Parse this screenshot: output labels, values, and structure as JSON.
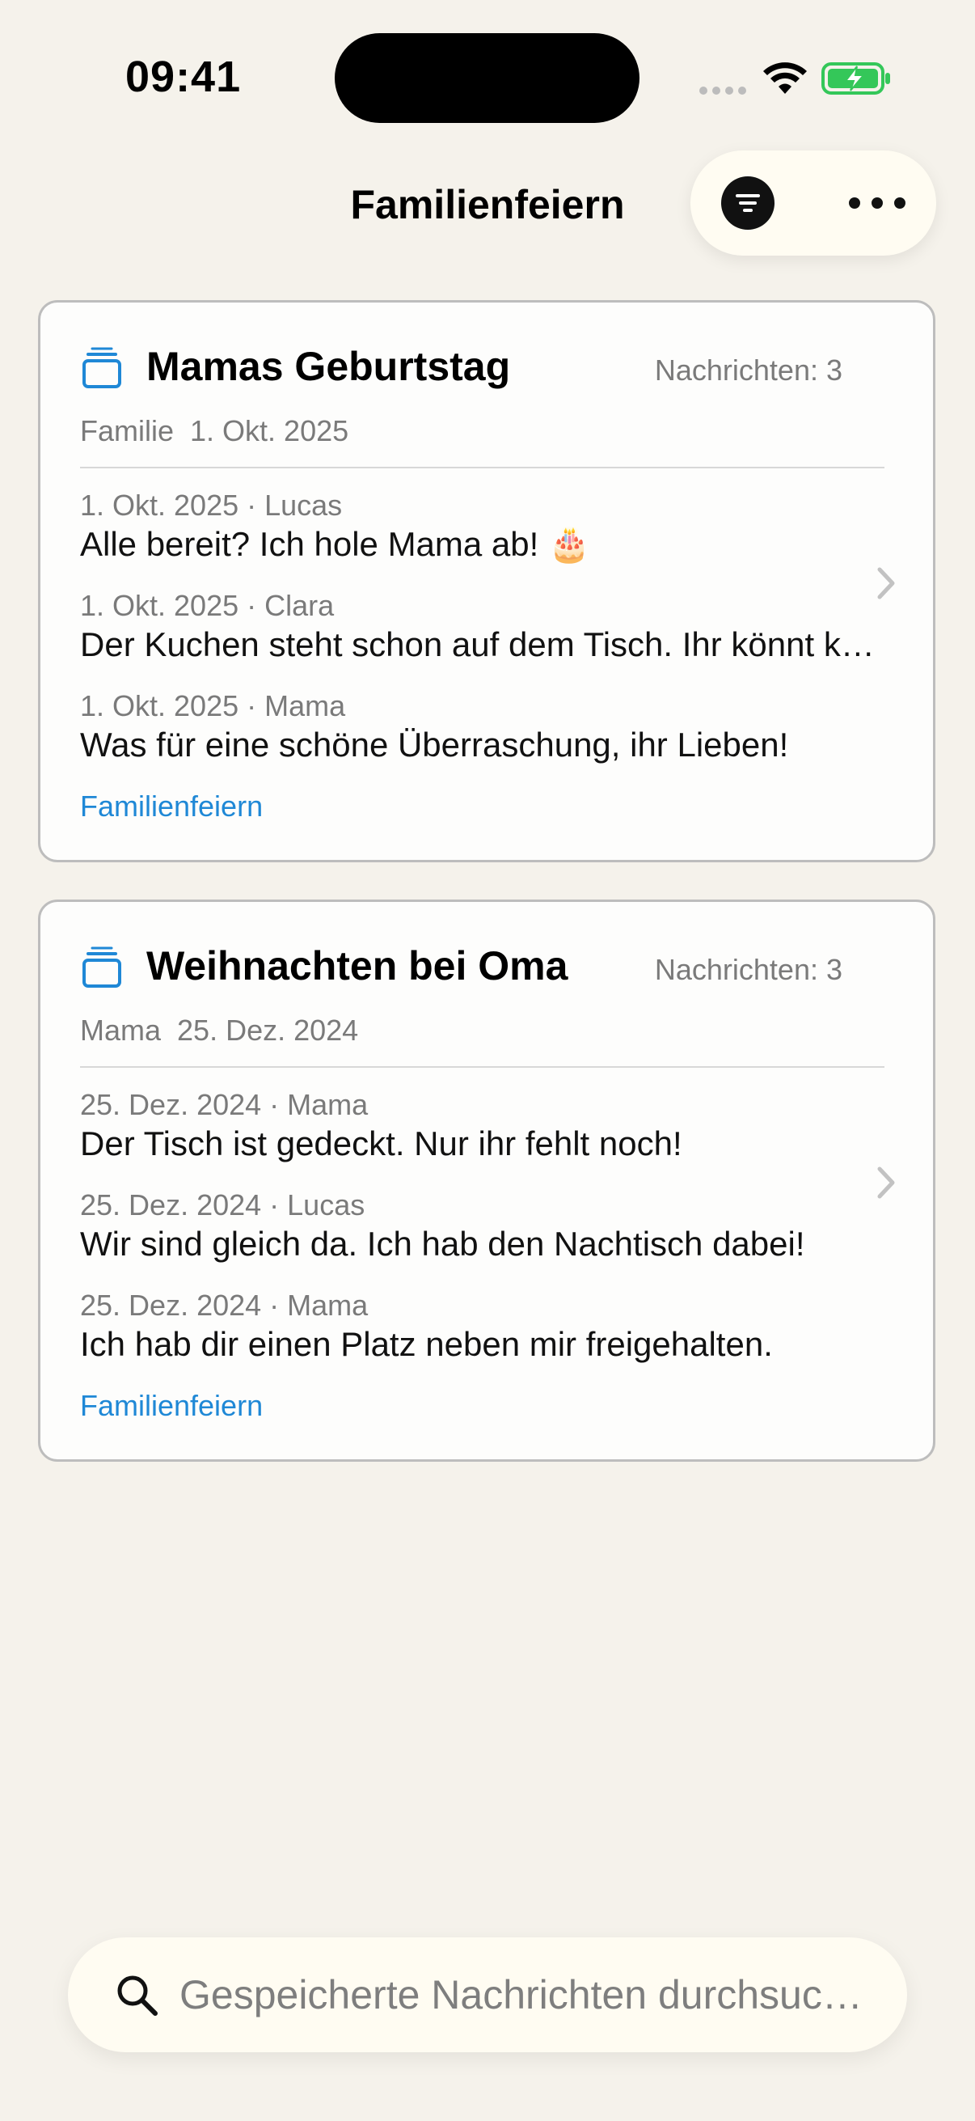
{
  "status_bar": {
    "time": "09:41",
    "icons": [
      "cellular-dots-icon",
      "wifi-icon",
      "battery-charging-icon"
    ],
    "battery_color": "#34c759"
  },
  "header": {
    "title": "Familienfeiern",
    "actions": [
      "filter-icon",
      "more-icon"
    ]
  },
  "cards": [
    {
      "title": "Mamas Geburtstag",
      "count_label": "Nachrichten: 3",
      "owner": "Familie",
      "date": "1. Okt. 2025",
      "messages": [
        {
          "meta": "1. Okt. 2025 · Lucas",
          "text": "Alle bereit? Ich hole Mama ab! 🎂"
        },
        {
          "meta": "1. Okt. 2025 · Clara",
          "text": "Der Kuchen steht schon auf dem Tisch. Ihr könnt kommen!"
        },
        {
          "meta": "1. Okt. 2025 · Mama",
          "text": "Was für eine schöne Überraschung, ihr Lieben!"
        }
      ],
      "tag": "Familienfeiern"
    },
    {
      "title": "Weihnachten bei Oma",
      "count_label": "Nachrichten: 3",
      "owner": "Mama",
      "date": "25. Dez. 2024",
      "messages": [
        {
          "meta": "25. Dez. 2024 · Mama",
          "text": "Der Tisch ist gedeckt. Nur ihr fehlt noch!"
        },
        {
          "meta": "25. Dez. 2024 · Lucas",
          "text": "Wir sind gleich da. Ich hab den Nachtisch dabei!"
        },
        {
          "meta": "25. Dez. 2024 · Mama",
          "text": "Ich hab dir einen Platz neben mir freigehalten."
        }
      ],
      "tag": "Familienfeiern"
    }
  ],
  "search": {
    "placeholder": "Gespeicherte Nachrichten durchsuc…",
    "value": ""
  },
  "colors": {
    "background": "#f5f2eb",
    "accent": "#1f88d6",
    "card_border": "#bdbdbd"
  }
}
